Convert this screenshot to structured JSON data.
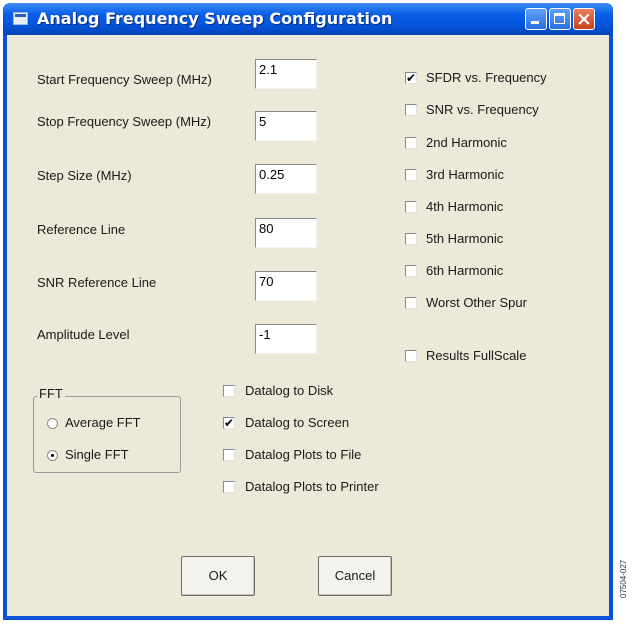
{
  "window": {
    "title": "Analog Frequency Sweep Configuration"
  },
  "fields": [
    {
      "label": "Start Frequency Sweep (MHz)",
      "value": "2.1"
    },
    {
      "label": "Stop Frequency Sweep (MHz)",
      "value": "5"
    },
    {
      "label": "Step Size (MHz)",
      "value": "0.25"
    },
    {
      "label": "Reference Line",
      "value": "80"
    },
    {
      "label": "SNR Reference Line",
      "value": "70"
    },
    {
      "label": "Amplitude Level",
      "value": "-1"
    }
  ],
  "plots": [
    {
      "label": "SFDR vs. Frequency",
      "checked": true
    },
    {
      "label": "SNR vs. Frequency",
      "checked": false
    },
    {
      "label": "2nd Harmonic",
      "checked": false
    },
    {
      "label": "3rd Harmonic",
      "checked": false
    },
    {
      "label": "4th Harmonic",
      "checked": false
    },
    {
      "label": "5th Harmonic",
      "checked": false
    },
    {
      "label": "6th Harmonic",
      "checked": false
    },
    {
      "label": "Worst Other Spur",
      "checked": false
    },
    {
      "label": "Results FullScale",
      "checked": false
    }
  ],
  "fft": {
    "legend": "FFT",
    "options": [
      {
        "label": "Average FFT",
        "selected": false
      },
      {
        "label": "Single FFT",
        "selected": true
      }
    ]
  },
  "datalog": [
    {
      "label": "Datalog to Disk",
      "checked": false
    },
    {
      "label": "Datalog to Screen",
      "checked": true
    },
    {
      "label": "Datalog Plots to File",
      "checked": false
    },
    {
      "label": "Datalog Plots to Printer",
      "checked": false
    }
  ],
  "buttons": {
    "ok": "OK",
    "cancel": "Cancel"
  },
  "side_code": "07504-027",
  "check_glyph": "✔"
}
